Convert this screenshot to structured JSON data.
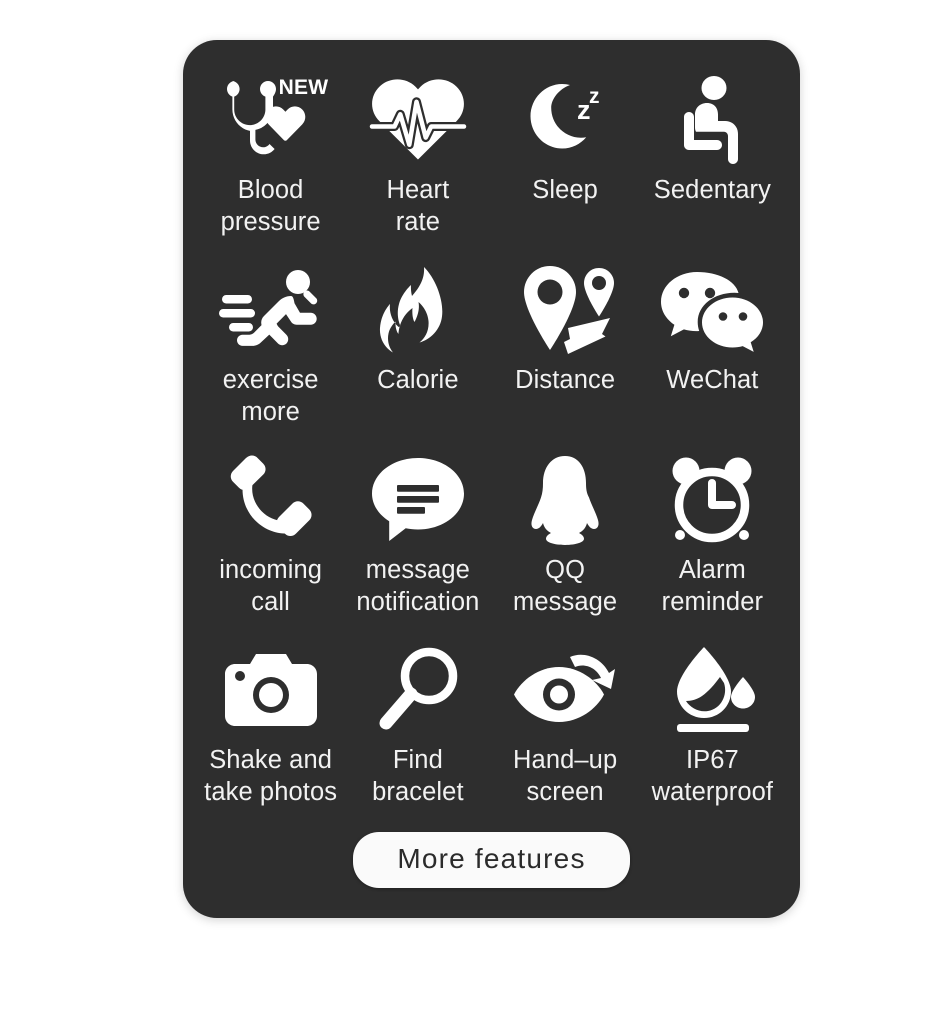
{
  "card": {
    "background_color": "#2e2e2e",
    "text_color": "#f2f2f2"
  },
  "badges": {
    "new": "NEW"
  },
  "features": [
    {
      "icon": "stethoscope-icon",
      "label": "Blood\npressure",
      "badge": "NEW"
    },
    {
      "icon": "heart-rate-icon",
      "label": "Heart\nrate"
    },
    {
      "icon": "moon-sleep-icon",
      "label": "Sleep"
    },
    {
      "icon": "sedentary-person-icon",
      "label": "Sedentary"
    },
    {
      "icon": "running-person-icon",
      "label": "exercise\nmore"
    },
    {
      "icon": "flame-icon",
      "label": "Calorie"
    },
    {
      "icon": "map-pin-route-icon",
      "label": "Distance"
    },
    {
      "icon": "wechat-icon",
      "label": "WeChat"
    },
    {
      "icon": "phone-handset-icon",
      "label": "incoming\ncall"
    },
    {
      "icon": "message-bubble-icon",
      "label": "message\nnotification"
    },
    {
      "icon": "qq-penguin-icon",
      "label": "QQ\nmessage"
    },
    {
      "icon": "alarm-clock-icon",
      "label": "Alarm\nreminder"
    },
    {
      "icon": "camera-icon",
      "label": "Shake and\ntake photos"
    },
    {
      "icon": "magnifier-icon",
      "label": "Find\nbracelet"
    },
    {
      "icon": "eye-raise-icon",
      "label": "Hand–up\nscreen"
    },
    {
      "icon": "water-drop-icon",
      "label": "IP67\nwaterproof"
    }
  ],
  "more_button": {
    "label": "More features"
  }
}
